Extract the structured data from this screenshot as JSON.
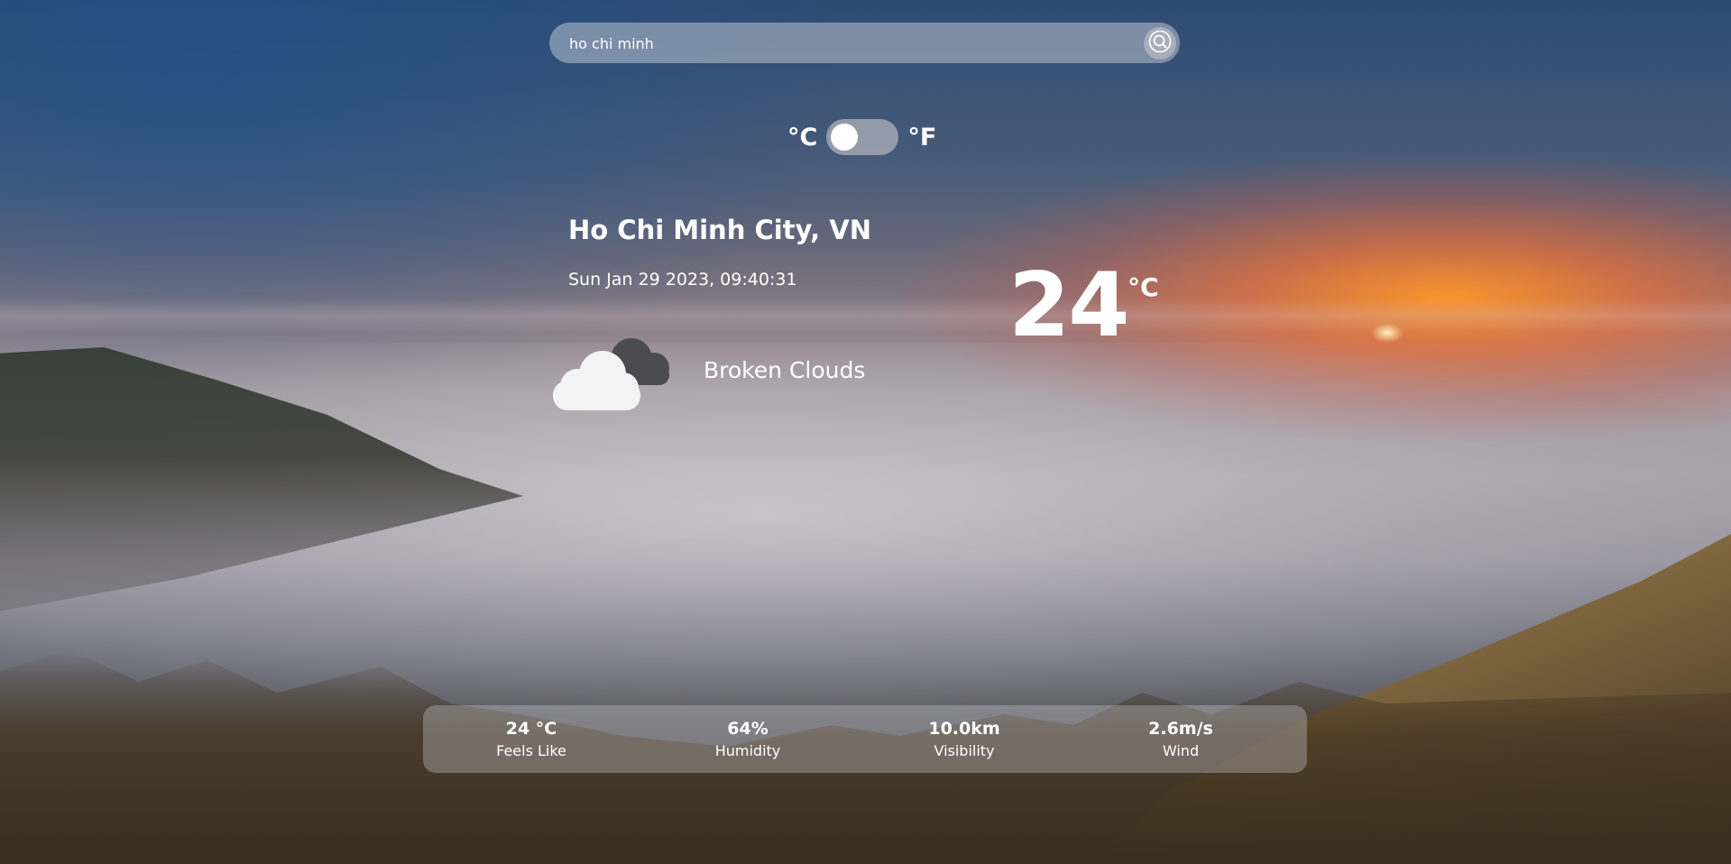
{
  "search": {
    "value": "ho chi minh",
    "icon": "search-icon"
  },
  "units": {
    "celsius_label": "°C",
    "fahrenheit_label": "°F",
    "selected": "celsius"
  },
  "location": {
    "city": "Ho Chi Minh City, VN",
    "datetime": "Sun Jan 29 2023, 09:40:31"
  },
  "current": {
    "icon": "broken-clouds-icon",
    "description": "Broken Clouds",
    "temperature": "24",
    "temperature_unit": "°C"
  },
  "stats": [
    {
      "value": "24 °C",
      "label": "Feels Like"
    },
    {
      "value": "64%",
      "label": "Humidity"
    },
    {
      "value": "10.0km",
      "label": "Visibility"
    },
    {
      "value": "2.6m/s",
      "label": "Wind"
    }
  ]
}
